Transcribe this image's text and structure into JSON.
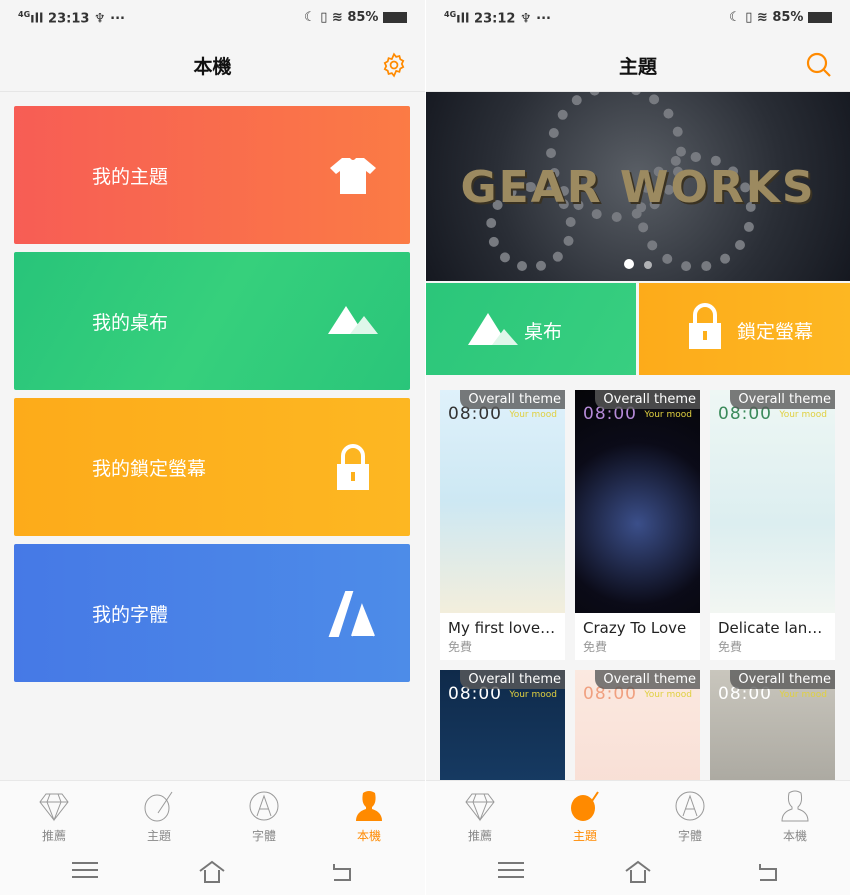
{
  "left": {
    "status": {
      "network": "4G",
      "time": "23:13",
      "battery": "85%"
    },
    "header": {
      "title": "本機",
      "action_icon": "gear-icon"
    },
    "cards": [
      {
        "label": "我的主題",
        "icon": "tshirt-icon",
        "color": "#f7624f"
      },
      {
        "label": "我的桌布",
        "icon": "mountain-icon",
        "color": "#2ec87a"
      },
      {
        "label": "我的鎖定螢幕",
        "icon": "lock-icon",
        "color": "#fdb01c"
      },
      {
        "label": "我的字體",
        "icon": "font-icon",
        "color": "#4a83e8"
      }
    ],
    "nav": [
      {
        "label": "推薦"
      },
      {
        "label": "主題"
      },
      {
        "label": "字體"
      },
      {
        "label": "本機",
        "active": true
      }
    ]
  },
  "right": {
    "status": {
      "network": "4G",
      "time": "23:12",
      "battery": "85%"
    },
    "header": {
      "title": "主題",
      "action_icon": "search-icon"
    },
    "banner": {
      "text": "GEAR WORKS",
      "pages": 2,
      "current": 1
    },
    "tiles": [
      {
        "label": "桌布",
        "color": "#2ec87a"
      },
      {
        "label": "鎖定螢幕",
        "color": "#fdb01c"
      }
    ],
    "themes": [
      {
        "badge": "Overall theme",
        "clock": "08:00",
        "mood": "Your mood",
        "name": "My first love f...",
        "price": "免費"
      },
      {
        "badge": "Overall theme",
        "clock": "08:00",
        "mood": "Your mood",
        "name": "Crazy To Love",
        "price": "免費"
      },
      {
        "badge": "Overall theme",
        "clock": "08:00",
        "mood": "Your mood",
        "name": "Delicate lang...",
        "price": "免費"
      },
      {
        "badge": "Overall theme",
        "clock": "08:00",
        "mood": "Your mood"
      },
      {
        "badge": "Overall theme",
        "clock": "08:00",
        "mood": "Your mood"
      },
      {
        "badge": "Overall theme",
        "clock": "08:00",
        "mood": "Your mood"
      }
    ],
    "nav": [
      {
        "label": "推薦"
      },
      {
        "label": "主題",
        "active": true
      },
      {
        "label": "字體"
      },
      {
        "label": "本機"
      }
    ]
  },
  "accent": "#ff8a00"
}
